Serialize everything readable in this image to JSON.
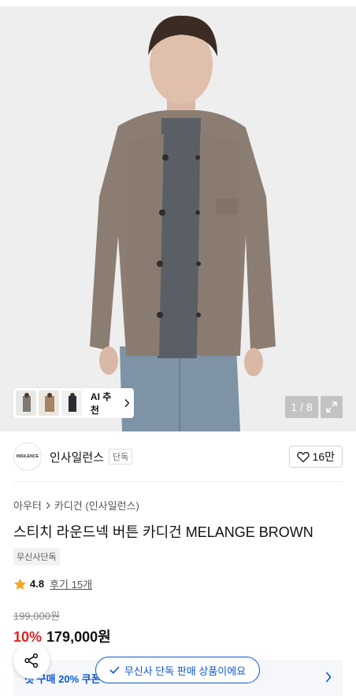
{
  "gallery": {
    "counter": "1 / 8",
    "ai_recommend_label": "AI 추천"
  },
  "brand": {
    "logo_text": "INSILENCE",
    "name": "인사일런스",
    "badge": "단독",
    "like_count": "16만"
  },
  "breadcrumb": {
    "level1": "아우터",
    "level2": "카디건 (인사일런스)"
  },
  "product": {
    "title": "스티치 라운드넥 버튼 카디건 MELANGE BROWN",
    "exclusive_badge": "무신사단독",
    "rating": "4.8",
    "review_label": "후기 15개",
    "original_price": "199,000원",
    "discount": "10%",
    "price": "179,000원"
  },
  "coupon": {
    "text": "첫 구매 20% 쿠폰"
  },
  "toast": {
    "text": "무신사 단독 판매 상품이에요"
  },
  "colors": {
    "accent_blue": "#0a57d6",
    "discount_red": "#e0221e",
    "star": "#f5a623"
  }
}
